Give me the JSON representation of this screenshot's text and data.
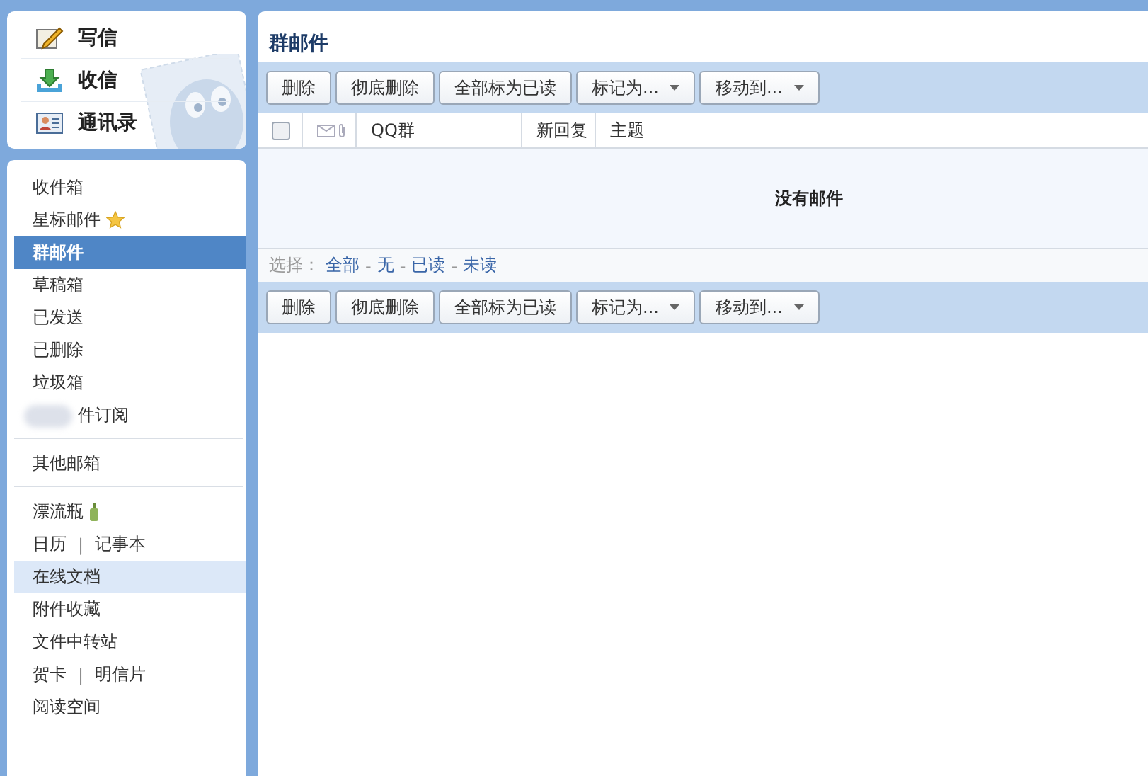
{
  "actions": [
    {
      "kind": "compose",
      "label": "写信"
    },
    {
      "kind": "receive",
      "label": "收信"
    },
    {
      "kind": "contacts",
      "label": "通讯录"
    }
  ],
  "folder_groups": [
    [
      {
        "kind": "plain",
        "label": "收件箱",
        "selected": false,
        "hovered": false
      },
      {
        "kind": "starred",
        "label": "星标邮件",
        "selected": false,
        "hovered": false
      },
      {
        "kind": "plain",
        "label": "群邮件",
        "selected": true,
        "hovered": false
      },
      {
        "kind": "plain",
        "label": "草稿箱",
        "selected": false,
        "hovered": false
      },
      {
        "kind": "plain",
        "label": "已发送",
        "selected": false,
        "hovered": false
      },
      {
        "kind": "plain",
        "label": "已删除",
        "selected": false,
        "hovered": false
      },
      {
        "kind": "plain",
        "label": "垃圾箱",
        "selected": false,
        "hovered": false
      },
      {
        "kind": "blurred",
        "label": "件订阅",
        "selected": false,
        "hovered": false
      }
    ],
    [
      {
        "kind": "plain",
        "label": "其他邮箱",
        "selected": false,
        "hovered": false
      }
    ],
    [
      {
        "kind": "bottle",
        "label": "漂流瓶",
        "selected": false,
        "hovered": false
      },
      {
        "kind": "pair",
        "label": "日历",
        "separator": "|",
        "label2": "记事本",
        "selected": false,
        "hovered": false
      },
      {
        "kind": "plain",
        "label": "在线文档",
        "selected": false,
        "hovered": true
      },
      {
        "kind": "plain",
        "label": "附件收藏",
        "selected": false,
        "hovered": false
      },
      {
        "kind": "plain",
        "label": "文件中转站",
        "selected": false,
        "hovered": false
      },
      {
        "kind": "pair",
        "label": "贺卡",
        "separator": "|",
        "label2": "明信片",
        "selected": false,
        "hovered": false
      },
      {
        "kind": "plain",
        "label": "阅读空间",
        "selected": false,
        "hovered": false
      }
    ]
  ],
  "title": "群邮件",
  "toolbar_top": [
    {
      "kind": "plain",
      "label": "删除"
    },
    {
      "kind": "plain",
      "label": "彻底删除"
    },
    {
      "kind": "plain",
      "label": "全部标为已读"
    },
    {
      "kind": "menu",
      "label": "标记为..."
    },
    {
      "kind": "menu",
      "label": "移动到..."
    }
  ],
  "table": {
    "select_all_checked": false,
    "columns": [
      "QQ群",
      "新回复",
      "主题"
    ],
    "empty_message": "没有邮件"
  },
  "select_bar": {
    "label": "选择：",
    "separator": "-",
    "links": [
      "全部",
      "无",
      "已读",
      "未读"
    ]
  },
  "toolbar_bottom": [
    {
      "kind": "plain",
      "label": "删除"
    },
    {
      "kind": "plain",
      "label": "彻底删除"
    },
    {
      "kind": "plain",
      "label": "全部标为已读"
    },
    {
      "kind": "menu",
      "label": "标记为..."
    },
    {
      "kind": "menu",
      "label": "移动到..."
    }
  ]
}
